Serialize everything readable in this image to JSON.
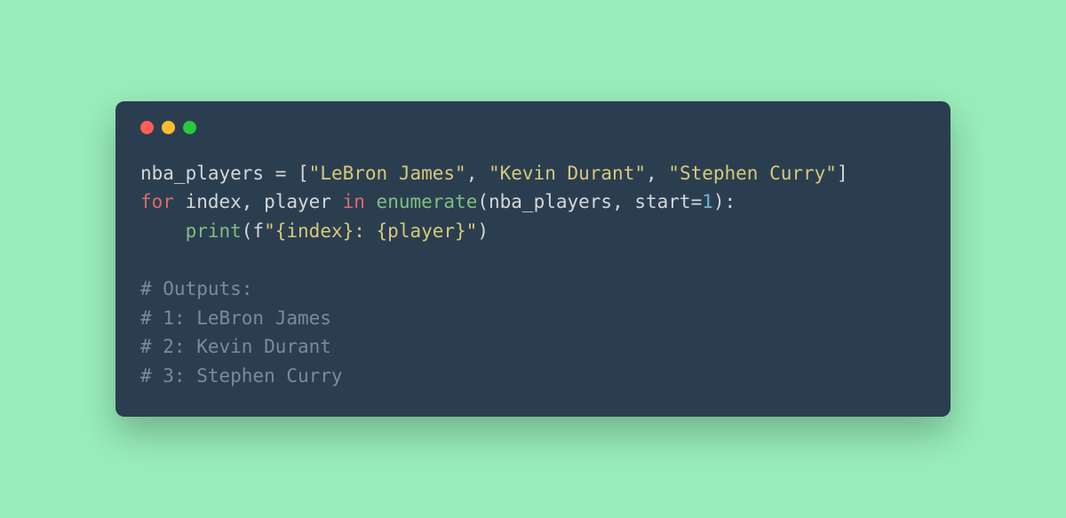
{
  "window": {
    "traffic_lights": {
      "red": "#ff5f56",
      "yellow": "#ffbd2e",
      "green": "#27c93f"
    }
  },
  "code": {
    "lines": [
      {
        "tokens": [
          {
            "cls": "t-default",
            "txt": "nba_players "
          },
          {
            "cls": "t-op",
            "txt": "= "
          },
          {
            "cls": "t-punc",
            "txt": "["
          },
          {
            "cls": "t-str",
            "txt": "\"LeBron James\""
          },
          {
            "cls": "t-default",
            "txt": ", "
          },
          {
            "cls": "t-str",
            "txt": "\"Kevin Durant\""
          },
          {
            "cls": "t-default",
            "txt": ", "
          },
          {
            "cls": "t-str",
            "txt": "\"Stephen Curry\""
          },
          {
            "cls": "t-punc",
            "txt": "]"
          }
        ]
      },
      {
        "tokens": [
          {
            "cls": "t-kw",
            "txt": "for"
          },
          {
            "cls": "t-default",
            "txt": " index, player "
          },
          {
            "cls": "t-kw",
            "txt": "in"
          },
          {
            "cls": "t-default",
            "txt": " "
          },
          {
            "cls": "t-func",
            "txt": "enumerate"
          },
          {
            "cls": "t-paren",
            "txt": "("
          },
          {
            "cls": "t-default",
            "txt": "nba_players, start="
          },
          {
            "cls": "t-num",
            "txt": "1"
          },
          {
            "cls": "t-paren",
            "txt": ")"
          },
          {
            "cls": "t-default",
            "txt": ":"
          }
        ]
      },
      {
        "tokens": [
          {
            "cls": "t-default",
            "txt": "    "
          },
          {
            "cls": "t-func",
            "txt": "print"
          },
          {
            "cls": "t-paren",
            "txt": "("
          },
          {
            "cls": "t-default",
            "txt": "f"
          },
          {
            "cls": "t-str",
            "txt": "\"{index}: {player}\""
          },
          {
            "cls": "t-paren",
            "txt": ")"
          }
        ]
      },
      {
        "tokens": [
          {
            "cls": "t-default",
            "txt": " "
          }
        ]
      },
      {
        "tokens": [
          {
            "cls": "t-comment",
            "txt": "# Outputs:"
          }
        ]
      },
      {
        "tokens": [
          {
            "cls": "t-comment",
            "txt": "# 1: LeBron James"
          }
        ]
      },
      {
        "tokens": [
          {
            "cls": "t-comment",
            "txt": "# 2: Kevin Durant"
          }
        ]
      },
      {
        "tokens": [
          {
            "cls": "t-comment",
            "txt": "# 3: Stephen Curry"
          }
        ]
      }
    ]
  }
}
